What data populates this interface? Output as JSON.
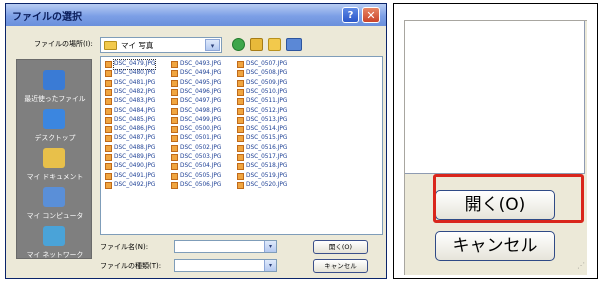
{
  "dialog": {
    "title": "ファイルの選択",
    "help_label": "?",
    "close_label": "✕",
    "location_label": "ファイルの場所(I):",
    "location_value": "マイ 写真",
    "location_dropdown_glyph": "▾",
    "places": [
      {
        "label": "最近使ったファイル",
        "icon": "recent-files-icon",
        "color": "#3a7bd5"
      },
      {
        "label": "デスクトップ",
        "icon": "desktop-icon",
        "color": "#3b86e0"
      },
      {
        "label": "マイ ドキュメント",
        "icon": "my-documents-icon",
        "color": "#e8c04a"
      },
      {
        "label": "マイ コンピュータ",
        "icon": "my-computer-icon",
        "color": "#5a8fd8"
      },
      {
        "label": "マイ ネットワーク",
        "icon": "my-network-icon",
        "color": "#4aa3d8"
      }
    ],
    "files": [
      "DSC_0479.JPG",
      "DSC_0480.JPG",
      "DSC_0481.JPG",
      "DSC_0482.JPG",
      "DSC_0483.JPG",
      "DSC_0484.JPG",
      "DSC_0485.JPG",
      "DSC_0486.JPG",
      "DSC_0487.JPG",
      "DSC_0488.JPG",
      "DSC_0489.JPG",
      "DSC_0490.JPG",
      "DSC_0491.JPG",
      "DSC_0492.JPG",
      "DSC_0493.JPG",
      "DSC_0494.JPG",
      "DSC_0495.JPG",
      "DSC_0496.JPG",
      "DSC_0497.JPG",
      "DSC_0498.JPG",
      "DSC_0499.JPG",
      "DSC_0500.JPG",
      "DSC_0501.JPG",
      "DSC_0502.JPG",
      "DSC_0503.JPG",
      "DSC_0504.JPG",
      "DSC_0505.JPG",
      "DSC_0506.JPG",
      "DSC_0507.JPG",
      "DSC_0508.JPG",
      "DSC_0509.JPG",
      "DSC_0510.JPG",
      "DSC_0511.JPG",
      "DSC_0512.JPG",
      "DSC_0513.JPG",
      "DSC_0514.JPG",
      "DSC_0515.JPG",
      "DSC_0516.JPG",
      "DSC_0517.JPG",
      "DSC_0518.JPG",
      "DSC_0519.JPG",
      "DSC_0520.JPG"
    ],
    "filename_label": "ファイル名(N):",
    "filetype_label": "ファイルの種類(T):",
    "open_label": "開く(O)",
    "cancel_label": "キャンセル",
    "dropdown_glyph": "▾"
  },
  "zoom": {
    "open_label": "開く(O)",
    "cancel_label": "キャンセル",
    "grip_glyph": "⋰"
  },
  "colors": {
    "highlight": "#d9261c",
    "title_bar": "#7c9fe6",
    "places_bar": "#7f7f7f",
    "file_text": "#1c3f95"
  }
}
